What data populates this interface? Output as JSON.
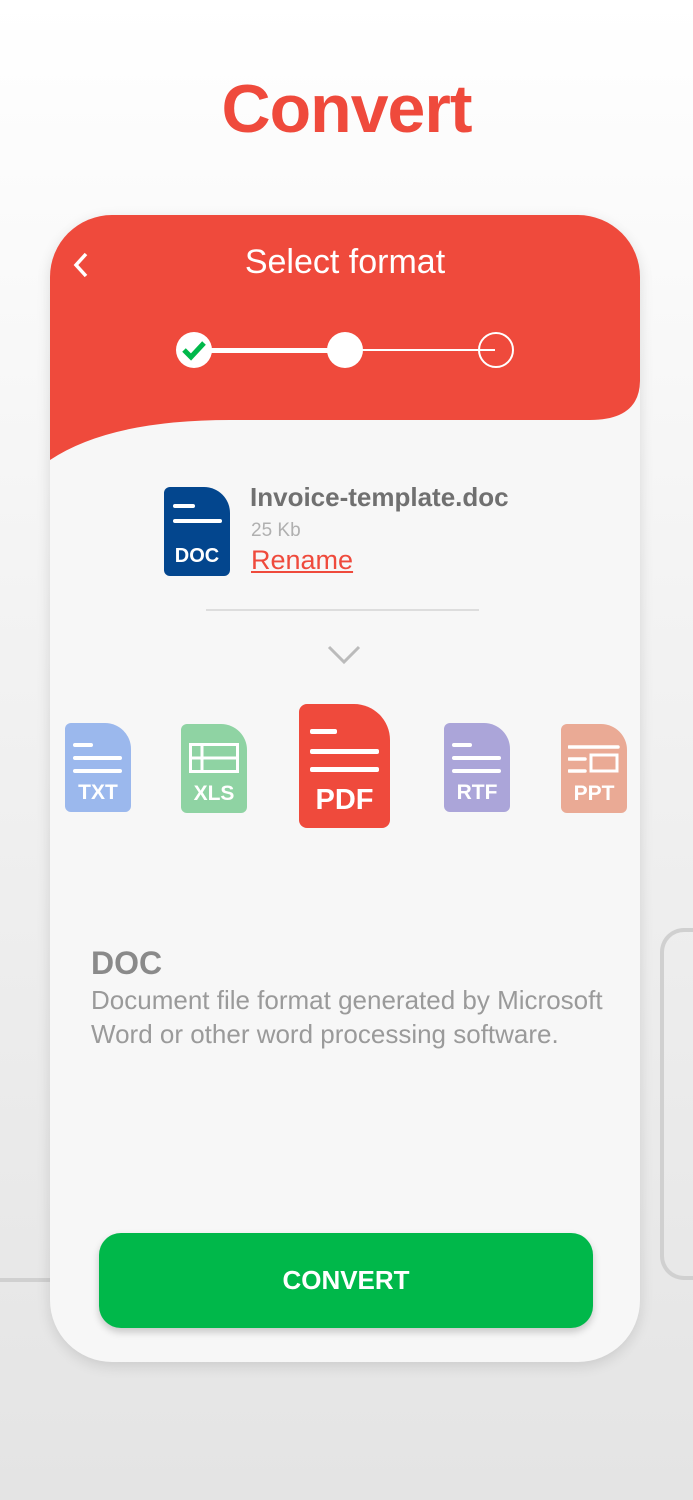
{
  "page_title": "Convert",
  "header": {
    "title": "Select format",
    "back_icon": "chevron-left-icon"
  },
  "stepper": {
    "steps": 3,
    "current_step": 2,
    "completed": [
      1
    ]
  },
  "file": {
    "name": "Invoice-template.doc",
    "size": "25 Kb",
    "rename_label": "Rename",
    "type_label": "DOC"
  },
  "formats": [
    {
      "label": "TXT",
      "color": "#9bb8ed",
      "selected": false
    },
    {
      "label": "XLS",
      "color": "#8fd3a3",
      "selected": false
    },
    {
      "label": "PDF",
      "color": "#ef4a3c",
      "selected": true
    },
    {
      "label": "RTF",
      "color": "#aba5d9",
      "selected": false
    },
    {
      "label": "PPT",
      "color": "#eaaa95",
      "selected": false
    }
  ],
  "description": {
    "title": "DOC",
    "text": "Document file format generated by Microsoft Word or other word processing software."
  },
  "convert_label": "CONVERT",
  "colors": {
    "accent": "#ef4a3c",
    "success": "#00b84a",
    "doc": "#03468e"
  }
}
